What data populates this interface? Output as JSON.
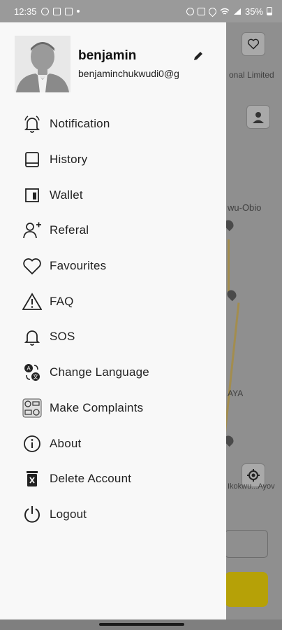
{
  "status_bar": {
    "time": "12:35",
    "battery": "35%"
  },
  "map": {
    "company_text": "onal Limited",
    "area_text": "wu-Obio",
    "area2_text": "AYA",
    "street_text": "Ikokwu...Ayov"
  },
  "profile": {
    "name": "benjamin",
    "email": "benjaminchukwudi0@g"
  },
  "menu": {
    "items": [
      {
        "label": "Notification",
        "icon": "bell-icon"
      },
      {
        "label": "History",
        "icon": "book-icon"
      },
      {
        "label": "Wallet",
        "icon": "wallet-icon"
      },
      {
        "label": "Referal",
        "icon": "add-person-icon"
      },
      {
        "label": "Favourites",
        "icon": "heart-icon"
      },
      {
        "label": "FAQ",
        "icon": "warning-icon"
      },
      {
        "label": "SOS",
        "icon": "alarm-bell-icon"
      },
      {
        "label": "Change Language",
        "icon": "translate-icon"
      },
      {
        "label": "Make Complaints",
        "icon": "complaint-icon"
      },
      {
        "label": "About",
        "icon": "info-icon"
      },
      {
        "label": "Delete Account",
        "icon": "trash-icon"
      },
      {
        "label": "Logout",
        "icon": "power-icon"
      }
    ]
  },
  "colors": {
    "drawer_bg": "#f8f8f8",
    "accent_yellow": "#b6a107",
    "text": "#222222"
  }
}
